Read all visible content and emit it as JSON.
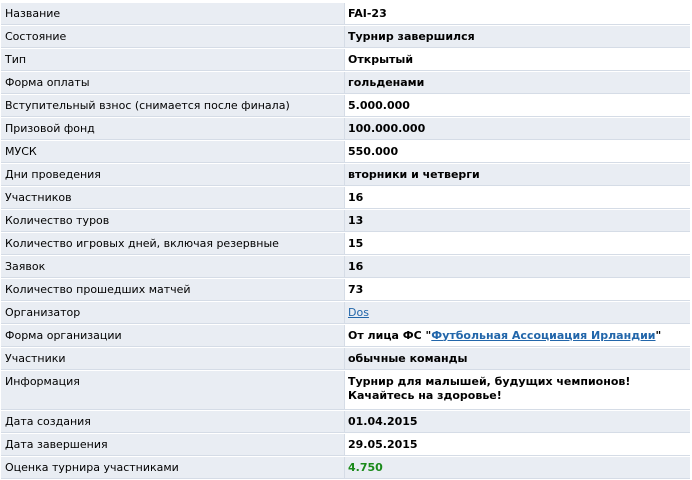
{
  "rows": [
    {
      "label": "Название",
      "value": "FAI-23"
    },
    {
      "label": "Состояние",
      "value": "Турнир завершился"
    },
    {
      "label": "Тип",
      "value": "Открытый"
    },
    {
      "label": "Форма оплаты",
      "value": "гольденами"
    },
    {
      "label": "Вступительный взнос (снимается после финала)",
      "value": "5.000.000"
    },
    {
      "label": "Призовой фонд",
      "value": "100.000.000"
    },
    {
      "label": "МУСК",
      "value": "550.000"
    },
    {
      "label": "Дни проведения",
      "value": "вторники и четверги"
    },
    {
      "label": "Участников",
      "value": "16"
    },
    {
      "label": "Количество туров",
      "value": "13"
    },
    {
      "label": "Количество игровых дней, включая резервные",
      "value": "15"
    },
    {
      "label": "Заявок",
      "value": "16"
    },
    {
      "label": "Количество прошедших матчей",
      "value": "73"
    },
    {
      "label": "Организатор",
      "value": "Dos"
    },
    {
      "label": "Форма организации",
      "prefix": "От лица ФС \"",
      "link": "Футбольная Ассоциация Ирландии",
      "suffix": "\""
    },
    {
      "label": "Участники",
      "value": "обычные команды"
    },
    {
      "label": "Информация",
      "value": "Турнир для малышей, будущих чемпионов! Качайтесь на здоровье!"
    },
    {
      "label": "Дата создания",
      "value": "01.04.2015"
    },
    {
      "label": "Дата завершения",
      "value": "29.05.2015"
    },
    {
      "label": "Оценка турнира участниками",
      "value": "4.750"
    }
  ],
  "colors": {
    "label_bg": "#e9edf3",
    "border": "#d5dce6",
    "link": "#2266aa",
    "rating": "#1a8a1a"
  }
}
